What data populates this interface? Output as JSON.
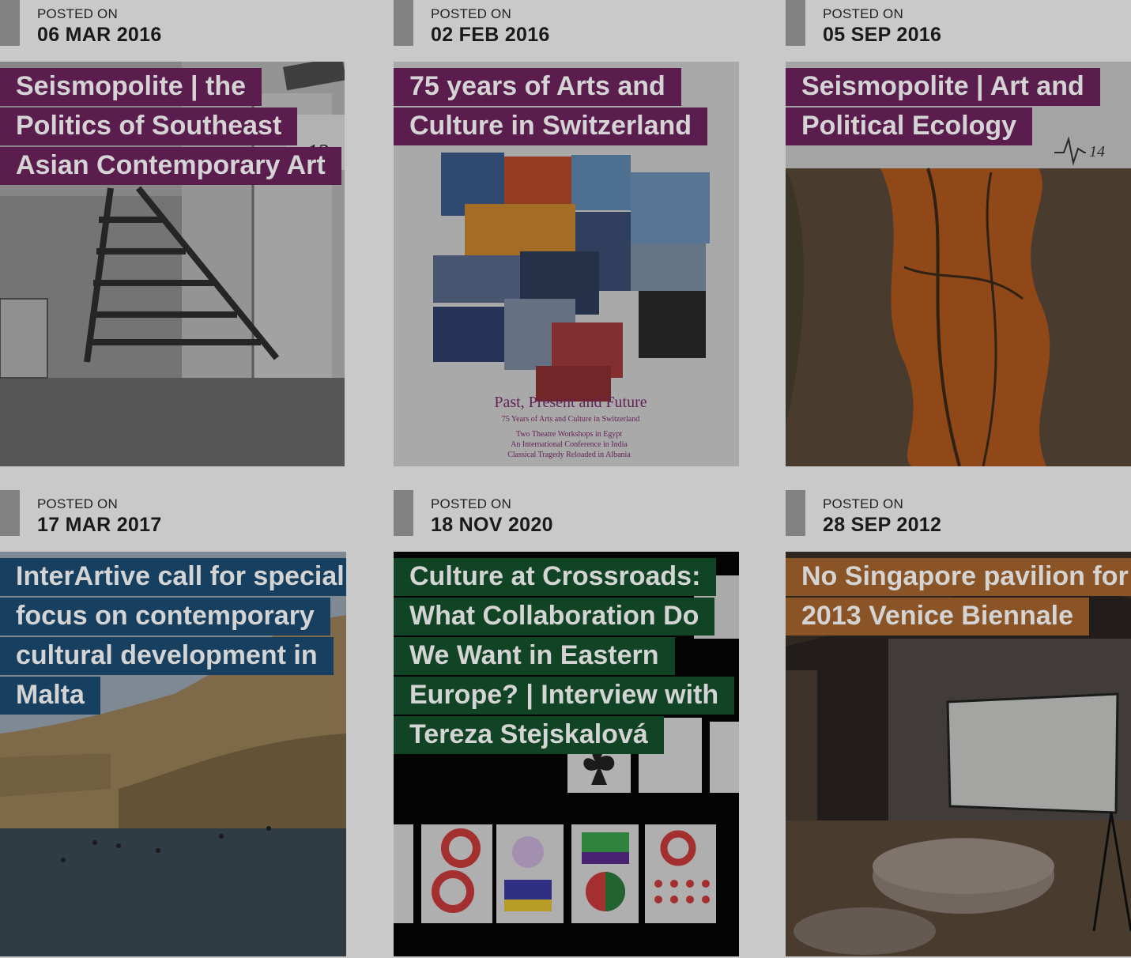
{
  "posts": [
    {
      "posted_label": "POSTED ON",
      "date": "06 MAR 2016",
      "title": "Seismopolite | the Politics of Southeast Asian Contemporary Art",
      "tag_color": "#5a1d4e",
      "image_text": "13"
    },
    {
      "posted_label": "POSTED ON",
      "date": "02 FEB 2016",
      "title": "75 years of Arts and Culture in Switzerland",
      "tag_color": "#5a1d4e",
      "image_title": "Past, Present and Future",
      "image_subtitle": "75 Years of Arts and Culture in Switzerland",
      "image_lines": [
        "Two Theatre Workshops in Egypt",
        "An International Conference in India",
        "Classical Tragedy Reloaded in Albania"
      ]
    },
    {
      "posted_label": "POSTED ON",
      "date": "05 SEP 2016",
      "title": "Seismopolite | Art and Political Ecology",
      "tag_color": "#5a1d4e",
      "image_text": "14"
    },
    {
      "posted_label": "POSTED ON",
      "date": "17 MAR 2017",
      "title": "InterArtive call for special focus on contemporary cultural development in Malta",
      "tag_color": "#173f5f"
    },
    {
      "posted_label": "POSTED ON",
      "date": "18 NOV 2020",
      "title": "Culture at Crossroads: What Collaboration Do We Want in Eastern Europe? | Interview with Tereza Stejskalová",
      "tag_color": "#114424"
    },
    {
      "posted_label": "POSTED ON",
      "date": "28 SEP 2012",
      "title": "No Singapore pavilion for 2013 Venice Biennale",
      "tag_color": "#8a5426"
    }
  ]
}
